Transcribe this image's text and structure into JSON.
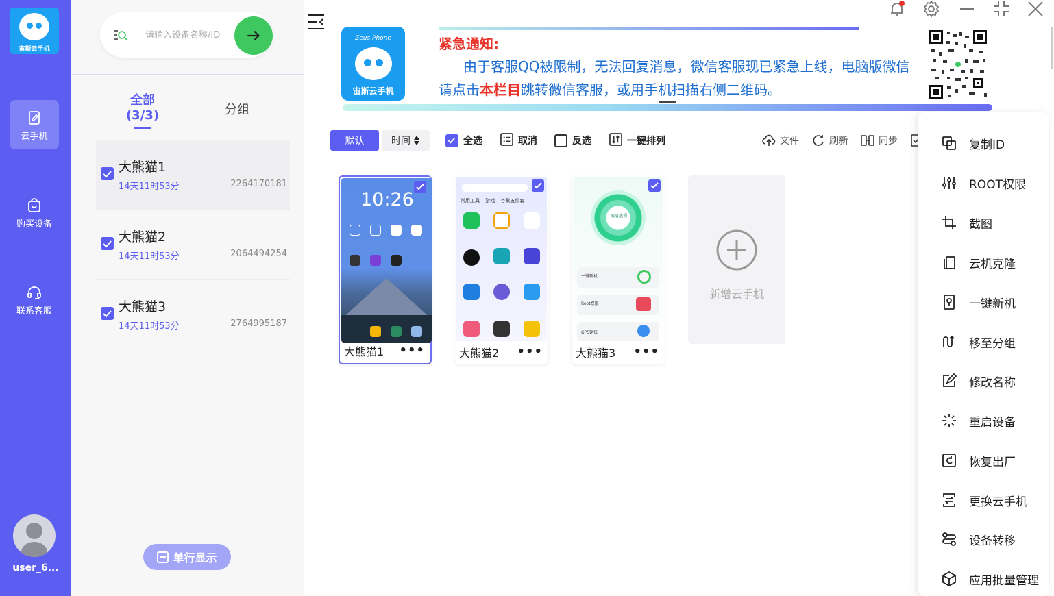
{
  "nav": {
    "logo_text": "宙斯云手机",
    "items": [
      {
        "label": "云手机",
        "icon": "phone-edit-icon",
        "active": true
      },
      {
        "label": "购买设备",
        "icon": "bag-icon",
        "active": false
      },
      {
        "label": "联系客服",
        "icon": "headset-icon",
        "active": false
      }
    ],
    "username": "user_6..."
  },
  "search": {
    "placeholder": "请输入设备名称/ID"
  },
  "tabs": {
    "all_label": "全部",
    "all_count": "(3/3)",
    "group_label": "分组"
  },
  "devices": [
    {
      "name": "大熊猫1",
      "time": "14天11时53分",
      "id": "2264170181",
      "checked": true
    },
    {
      "name": "大熊猫2",
      "time": "14天11时53分",
      "id": "2064494254",
      "checked": true
    },
    {
      "name": "大熊猫3",
      "time": "14天11时53分",
      "id": "2764995187",
      "checked": true
    }
  ],
  "single_display_label": "单行显示",
  "banner": {
    "logo_zeus": "Zeus Phone",
    "logo_brand": "宙斯云手机",
    "title": "紧急通知:",
    "body_part1": "由于客服QQ被限制，无法回复消息，微信客服现已紧急上线，电脑版微信请点击",
    "body_highlight": "本栏目",
    "body_part2": "跳转微信客服，或用手机扫描右侧二维码。"
  },
  "toolbar": {
    "default_label": "默认",
    "time_label": "时间",
    "select_all": "全选",
    "cancel": "取消",
    "invert": "反选",
    "sort": "一键排列",
    "file": "文件",
    "refresh": "刷新",
    "sync": "同步"
  },
  "phones": [
    {
      "name": "大熊猫1",
      "clock": "10:26",
      "selected": true
    },
    {
      "name": "大熊猫2",
      "selected": false
    },
    {
      "name": "大熊猫3",
      "selected": false
    }
  ],
  "phone2_tabs": [
    "常用工具",
    "游戏",
    "谷歌五件套"
  ],
  "phone3_badge": "底层透视",
  "phone3_cards": [
    "一键新机",
    "Root权限",
    "GPS定位"
  ],
  "add_phone_label": "新增云手机",
  "context_menu": [
    {
      "label": "复制ID",
      "icon": "copy-id-icon"
    },
    {
      "label": "ROOT权限",
      "icon": "sliders-icon"
    },
    {
      "label": "截图",
      "icon": "crop-icon"
    },
    {
      "label": "云机克隆",
      "icon": "clone-icon"
    },
    {
      "label": "一键新机",
      "icon": "new-device-icon"
    },
    {
      "label": "移至分组",
      "icon": "move-group-icon"
    },
    {
      "label": "修改名称",
      "icon": "edit-icon"
    },
    {
      "label": "重启设备",
      "icon": "restart-spinner-icon"
    },
    {
      "label": "恢复出厂",
      "icon": "factory-reset-icon"
    },
    {
      "label": "更换云手机",
      "icon": "swap-phone-icon"
    },
    {
      "label": "设备转移",
      "icon": "transfer-icon"
    },
    {
      "label": "应用批量管理",
      "icon": "cube-icon"
    }
  ],
  "colors": {
    "accent": "#5b5ef0",
    "go_button": "#3ec85f",
    "notice_red": "#e8332a",
    "notice_blue": "#1f6fd1"
  }
}
